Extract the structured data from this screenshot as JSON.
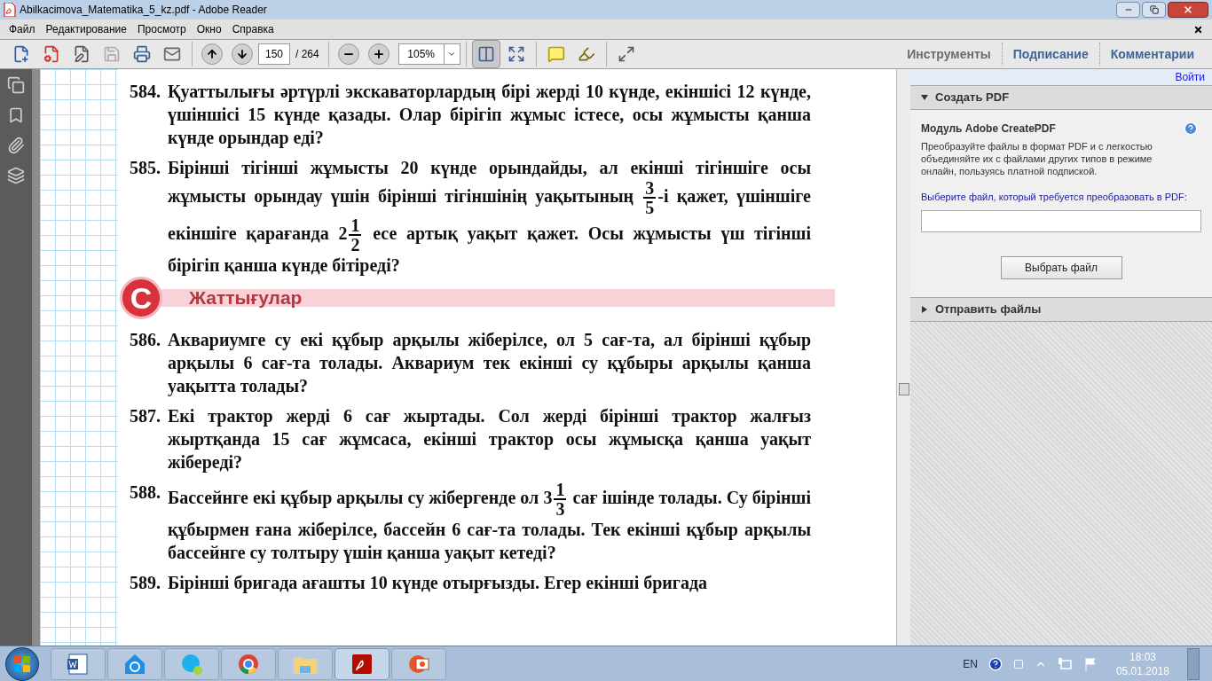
{
  "window": {
    "title": "Abilkacimova_Matematika_5_kz.pdf - Adobe Reader"
  },
  "menu": [
    "Файл",
    "Редактирование",
    "Просмотр",
    "Окно",
    "Справка"
  ],
  "toolbar": {
    "page": "150",
    "page_total": "/ 264",
    "zoom": "105%",
    "fit_page_selected": true,
    "right_tabs": [
      {
        "label": "Инструменты",
        "color": "#6b6b6b"
      },
      {
        "label": "Подписание",
        "color": "#3f6497"
      },
      {
        "label": "Комментарии",
        "color": "#3f6497"
      }
    ]
  },
  "document": {
    "problems_before": [
      {
        "number": "584.",
        "segments": [
          {
            "kind": "text",
            "text": "Қуаттылығы әртүрлі экскаваторлардың бірі жерді 10 күнде, екіншісі 12 күнде, үшіншісі 15 күнде қазады. Олар бірігіп жұмыс істесе, осы жұмысты қанша күнде орындар еді?"
          }
        ]
      },
      {
        "number": "585.",
        "segments": [
          {
            "kind": "text",
            "text": "Бірінші тігінші жұмысты 20 күнде орындайды, ал екінші тігіншіге осы жұмысты орындау үшін бірінші тігіншінің уақытының "
          },
          {
            "kind": "fraction",
            "numerator": "3",
            "denominator": "5"
          },
          {
            "kind": "text",
            "text": "-і қажет, үшіншіге екіншіге қарағанда 2"
          },
          {
            "kind": "fraction",
            "numerator": "1",
            "denominator": "2"
          },
          {
            "kind": "text",
            "text": " есе артық уақыт қажет. Осы жұмысты үш тігінші бірігіп қанша күнде бітіреді?"
          }
        ]
      }
    ],
    "section": {
      "letter": "C",
      "title": "Жаттығулар"
    },
    "problems_after": [
      {
        "number": "586.",
        "segments": [
          {
            "kind": "text",
            "text": "Аквариумге су екі құбыр арқылы жіберілсе, ол 5 сағ-та, ал бірінші құбыр арқылы 6 сағ-та толады. Аквариум тек екінші су құбыры арқылы қанша уақытта толады?"
          }
        ]
      },
      {
        "number": "587.",
        "segments": [
          {
            "kind": "text",
            "text": "Екі трактор жерді 6 сағ жыртады. Сол жерді бірінші трактор жалғыз жыртқанда 15 сағ жұмсаса, екінші трактор осы жұмысқа қанша уақыт жібереді?"
          }
        ]
      },
      {
        "number": "588.",
        "segments": [
          {
            "kind": "text",
            "text": "Бассейнге екі құбыр арқылы су жібергенде ол 3"
          },
          {
            "kind": "fraction",
            "numerator": "1",
            "denominator": "3"
          },
          {
            "kind": "text",
            "text": " сағ ішінде толады. Су бірінші құбырмен ғана жіберілсе, бассейн 6 сағ-та толады. Тек екінші құбыр арқылы бассейнге су толтыру үшін қанша уақыт кетеді?"
          }
        ]
      },
      {
        "number": "589.",
        "segments": [
          {
            "kind": "text",
            "text": "Бірінші бригада ағашты 10 күнде отырғызды. Егер екінші бригада"
          }
        ]
      }
    ]
  },
  "right_pane": {
    "sign_in": "Войти",
    "sections": [
      {
        "title": "Создать PDF",
        "expanded": true
      },
      {
        "title": "Отправить файлы",
        "expanded": false
      }
    ],
    "module_title": "Модуль Adobe CreatePDF",
    "description": "Преобразуйте файлы в формат PDF и с легкостью объединяйте их с файлами других типов в режиме онлайн, пользуясь платной подпиской.",
    "file_label": "Выберите файл, который требуется преобразовать в PDF:",
    "button": "Выбрать файл"
  },
  "taskbar": {
    "language": "EN",
    "time": "18:03",
    "date": "05.01.2018"
  }
}
